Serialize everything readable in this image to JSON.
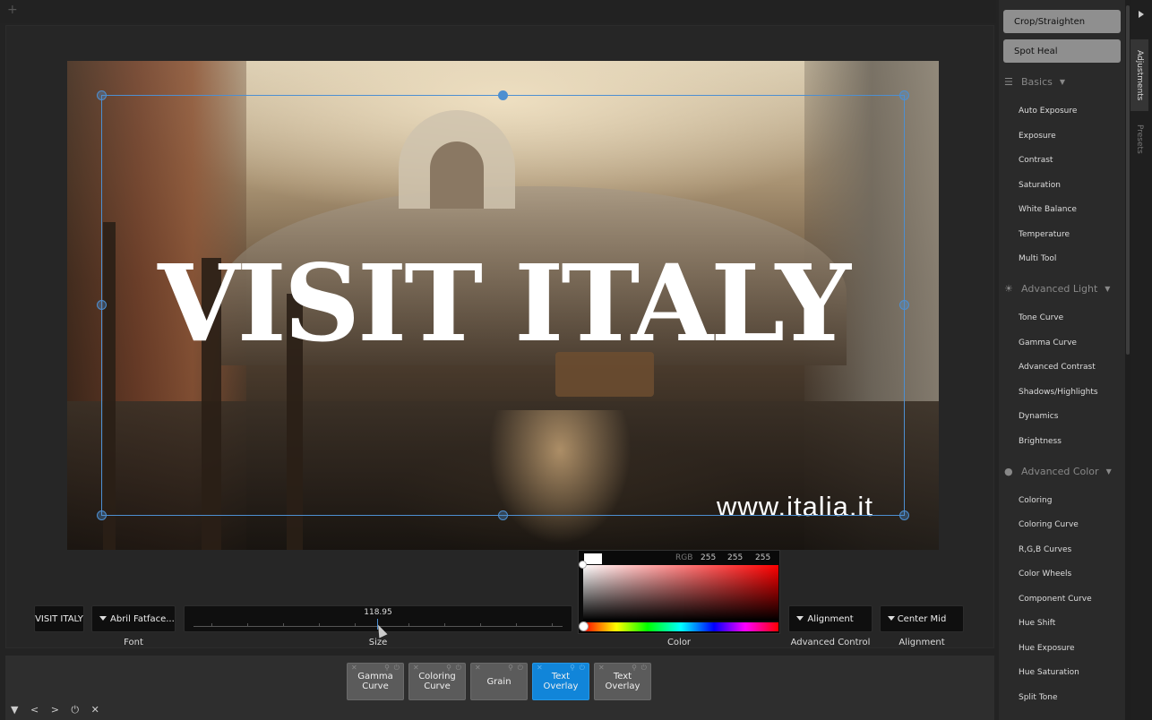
{
  "toolbar": {
    "add_icon": "+"
  },
  "canvas": {
    "overlay_text": "VISIT ITALY",
    "watermark_text": "www.italia.it"
  },
  "controls": {
    "text_value": "VISIT ITALY",
    "font_value": "Abril Fatface...",
    "font_label": "Font",
    "size_value": "118.95",
    "size_label": "Size",
    "color_mode": "RGB",
    "color_r": "255",
    "color_g": "255",
    "color_b": "255",
    "color_label": "Color",
    "advanced_value": "Alignment",
    "advanced_label": "Advanced Control",
    "alignment_value": "Center Mid",
    "alignment_label": "Alignment"
  },
  "stack": [
    {
      "label": "Gamma\nCurve",
      "active": false
    },
    {
      "label": "Coloring\nCurve",
      "active": false
    },
    {
      "label": "Grain",
      "active": false
    },
    {
      "label": "Text Overlay",
      "active": true
    },
    {
      "label": "Text Overlay",
      "active": false
    }
  ],
  "bottom_icons": [
    "collapse-icon",
    "prev-icon",
    "next-icon",
    "power-icon",
    "close-icon"
  ],
  "sidebar": {
    "crop_label": "Crop/Straighten",
    "heal_label": "Spot Heal",
    "sections": [
      {
        "title": "Basics",
        "icon": "sliders-icon",
        "items": [
          "Auto Exposure",
          "Exposure",
          "Contrast",
          "Saturation",
          "White Balance",
          "Temperature",
          "Multi Tool"
        ]
      },
      {
        "title": "Advanced Light",
        "icon": "sun-icon",
        "items": [
          "Tone Curve",
          "Gamma Curve",
          "Advanced Contrast",
          "Shadows/Highlights",
          "Dynamics",
          "Brightness"
        ]
      },
      {
        "title": "Advanced Color",
        "icon": "droplets-icon",
        "items": [
          "Coloring",
          "Coloring Curve",
          "R,G,B Curves",
          "Color Wheels",
          "Component Curve",
          "Hue Shift",
          "Hue Exposure",
          "Hue Saturation",
          "Split Tone"
        ]
      }
    ]
  },
  "right_tabs": {
    "adjustments": "Adjustments",
    "presets": "Presets"
  }
}
